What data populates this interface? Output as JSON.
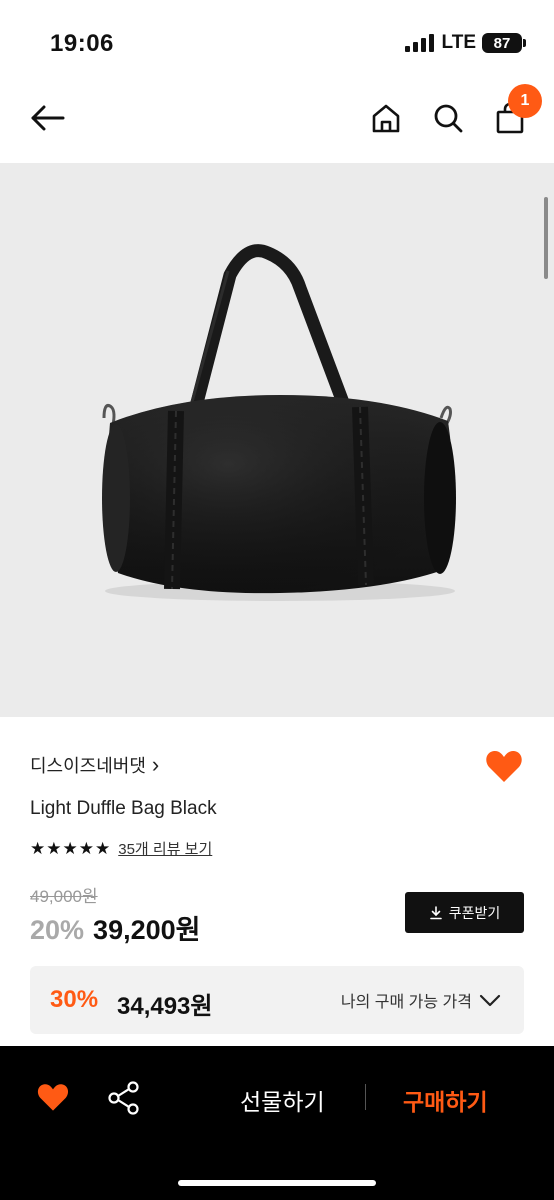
{
  "status_bar": {
    "time": "19:06",
    "network": "LTE",
    "battery": "87"
  },
  "header": {
    "back_icon": "arrow-left-icon",
    "home_icon": "home-icon",
    "search_icon": "search-icon",
    "cart_icon": "shopping-bag-icon",
    "cart_count": "1"
  },
  "product": {
    "image_alt": "black-duffle-bag-image",
    "brand": "디스이즈네버댓",
    "brand_chevron": "›",
    "name": "Light Duffle Bag Black",
    "rating_stars": 5,
    "review_link": "35개 리뷰 보기",
    "original_price": "49,000원",
    "discount_rate": "20%",
    "sale_price": "39,200원",
    "coupon_label": "쿠폰받기",
    "wished": true
  },
  "member_price": {
    "rate": "30%",
    "price": "34,493원",
    "label": "나의 구매 가능 가격"
  },
  "bottom_bar": {
    "gift_label": "선물하기",
    "buy_label": "구매하기"
  },
  "colors": {
    "accent": "#ff5a14",
    "image_bg": "#ebebeb",
    "bottom_bar": "#000000"
  }
}
